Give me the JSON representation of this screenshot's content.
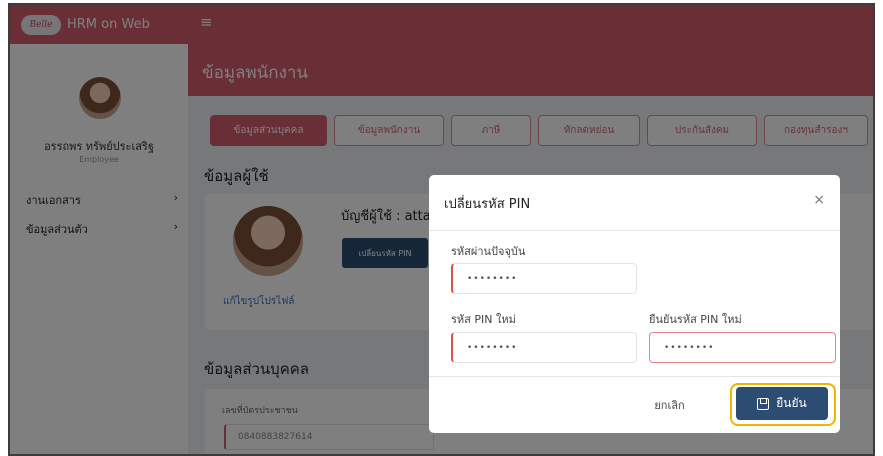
{
  "app": {
    "logo_text": "Belle",
    "name": "HRM on Web",
    "menu_icon": "≡"
  },
  "sidebar": {
    "user_name": "อรรถพร ทรัพย์ประเสริฐ",
    "user_role": "Employee",
    "menu": [
      {
        "label": "งานเอกสาร",
        "arrow": "›"
      },
      {
        "label": "ข้อมูลส่วนตัว",
        "arrow": "›"
      }
    ]
  },
  "page": {
    "title": "ข้อมูลพนักงาน",
    "tabs": [
      "ข้อมูลส่วนบุคคล",
      "ข้อมูลพนักงาน",
      "ภาษี",
      "หักลดหย่อน",
      "ประกันสังคม",
      "กองทุนสำรองฯ"
    ],
    "user_section_title": "ข้อมูลผู้ใช้",
    "account_label": "บัญชีผู้ใช้ : attapo",
    "change_pin_button": "เปลี่ยนรหัส PIN",
    "edit_photo_link": "แก้ไขรูปโปรไฟล์",
    "personal_section_title": "ข้อมูลส่วนบุคคล",
    "id_card_label": "เลขที่บัตรประชาชน",
    "id_card_value": "0840883827614"
  },
  "modal": {
    "title": "เปลี่ยนรหัส PIN",
    "close_icon": "×",
    "current_label": "รหัสผ่านปัจจุบัน",
    "current_value": "••••••••",
    "new_label": "รหัส PIN ใหม่",
    "new_value": "••••••••",
    "confirm_label": "ยืนยันรหัส PIN ใหม่",
    "confirm_value": "••••••••",
    "cancel_button": "ยกเลิก",
    "submit_button": "ยืนยัน"
  },
  "colors": {
    "brand": "#d45f6c",
    "primary_button": "#2d4c72",
    "highlight": "#f1b500"
  }
}
